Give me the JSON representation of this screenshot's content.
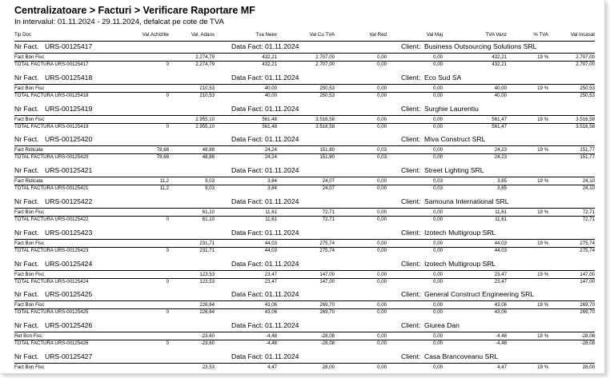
{
  "report": {
    "title": "Centralizatoare > Facturi > Verificare Raportare MF",
    "subtitle": "In intervalul: 01.11.2024 - 29.11.2024, defalcat pe cote de TVA"
  },
  "columns": [
    "Tip Doc",
    "Val.Achizitie",
    "Val. Adaos",
    "Tva Neex",
    "Val Cu TVA",
    "Val Red",
    "Val Maj",
    "TVA Vanz",
    "% TVA",
    "Val Incasat"
  ],
  "labels": {
    "nr_fact": "Nr Fact.",
    "data_fact": "Data Fact:",
    "client": "Client:",
    "total_prefix": "TOTAL FACTURA"
  },
  "invoices": [
    {
      "nr": "URS-00125417",
      "date": "01.11.2024",
      "client": "Business Outsourcing Solutions SRL",
      "row": {
        "type": "Fact Bon Fisc",
        "ach": "",
        "adaos": "2.274,79",
        "tva_neex": "432,21",
        "cu_tva": "2.707,00",
        "red": "0,00",
        "maj": "0,00",
        "tva_vanz": "432,21",
        "pct": "19 %",
        "incasat": "2.707,00"
      },
      "total": {
        "label": "TOTAL FACTURA URS-00125417",
        "ach": "0",
        "adaos": "2.274,79",
        "tva_neex": "432,21",
        "cu_tva": "2.707,00",
        "red": "0,00",
        "maj": "0,00",
        "tva_vanz": "432,21",
        "incasat": "2.707,00"
      }
    },
    {
      "nr": "URS-00125418",
      "date": "01.11.2024",
      "client": "Eco Sud SA",
      "row": {
        "type": "Fact Bon Fisc",
        "ach": "",
        "adaos": "210,53",
        "tva_neex": "40,00",
        "cu_tva": "250,53",
        "red": "0,00",
        "maj": "0,00",
        "tva_vanz": "40,00",
        "pct": "19 %",
        "incasat": "250,53"
      },
      "total": {
        "label": "TOTAL FACTURA URS-00125418",
        "ach": "0",
        "adaos": "210,53",
        "tva_neex": "40,00",
        "cu_tva": "250,53",
        "red": "0,00",
        "maj": "0,00",
        "tva_vanz": "40,00",
        "incasat": "250,53"
      }
    },
    {
      "nr": "URS-00125419",
      "date": "01.11.2024",
      "client": "Surghie Laurentiu",
      "row": {
        "type": "Fact Bon Fisc",
        "ach": "",
        "adaos": "2.955,10",
        "tva_neex": "561,48",
        "cu_tva": "3.516,58",
        "red": "0,00",
        "maj": "0,00",
        "tva_vanz": "561,47",
        "pct": "19 %",
        "incasat": "3.516,58"
      },
      "total": {
        "label": "TOTAL FACTURA URS-00125419",
        "ach": "0",
        "adaos": "2.955,10",
        "tva_neex": "561,48",
        "cu_tva": "3.516,58",
        "red": "0,00",
        "maj": "0,00",
        "tva_vanz": "561,47",
        "incasat": "3.516,58"
      }
    },
    {
      "nr": "URS-00125420",
      "date": "01.11.2024",
      "client": "Miva Construct SRL",
      "row": {
        "type": "Fact Ridicata",
        "ach": "78,68",
        "adaos": "48,88",
        "tva_neex": "24,24",
        "cu_tva": "151,80",
        "red": "0,03",
        "maj": "0,00",
        "tva_vanz": "24,23",
        "pct": "19 %",
        "incasat": "151,77"
      },
      "total": {
        "label": "TOTAL FACTURA URS-00125420",
        "ach": "78,68",
        "adaos": "48,88",
        "tva_neex": "24,24",
        "cu_tva": "151,80",
        "red": "0,03",
        "maj": "0,00",
        "tva_vanz": "24,23",
        "incasat": "151,77"
      }
    },
    {
      "nr": "URS-00125421",
      "date": "01.11.2024",
      "client": "Street Lighting SRL",
      "row": {
        "type": "Fact Ridicata",
        "ach": "11,2",
        "adaos": "9,03",
        "tva_neex": "3,84",
        "cu_tva": "24,07",
        "red": "0,00",
        "maj": "0,03",
        "tva_vanz": "3,85",
        "pct": "19 %",
        "incasat": "24,10"
      },
      "total": {
        "label": "TOTAL FACTURA URS-00125421",
        "ach": "11,2",
        "adaos": "9,03",
        "tva_neex": "3,84",
        "cu_tva": "24,07",
        "red": "0,00",
        "maj": "0,03",
        "tva_vanz": "3,85",
        "incasat": "24,10"
      }
    },
    {
      "nr": "URS-00125422",
      "date": "01.11.2024",
      "client": "Samouna International SRL",
      "row": {
        "type": "Fact Bon Fisc",
        "ach": "",
        "adaos": "61,10",
        "tva_neex": "11,61",
        "cu_tva": "72,71",
        "red": "0,00",
        "maj": "0,00",
        "tva_vanz": "11,61",
        "pct": "19 %",
        "incasat": "72,71"
      },
      "total": {
        "label": "TOTAL FACTURA URS-00125422",
        "ach": "0",
        "adaos": "61,10",
        "tva_neex": "11,61",
        "cu_tva": "72,71",
        "red": "0,00",
        "maj": "0,00",
        "tva_vanz": "11,61",
        "incasat": "72,71"
      }
    },
    {
      "nr": "URS-00125423",
      "date": "01.11.2024",
      "client": "Izotech Multigroup SRL",
      "row": {
        "type": "Fact Bon Fisc",
        "ach": "",
        "adaos": "231,71",
        "tva_neex": "44,03",
        "cu_tva": "275,74",
        "red": "0,00",
        "maj": "0,00",
        "tva_vanz": "44,03",
        "pct": "19 %",
        "incasat": "275,74"
      },
      "total": {
        "label": "TOTAL FACTURA URS-00125423",
        "ach": "0",
        "adaos": "231,71",
        "tva_neex": "44,03",
        "cu_tva": "275,74",
        "red": "0,00",
        "maj": "0,00",
        "tva_vanz": "44,03",
        "incasat": "275,74"
      }
    },
    {
      "nr": "URS-00125424",
      "date": "01.11.2024",
      "client": "Izotech Multigroup SRL",
      "row": {
        "type": "Fact Bon Fisc",
        "ach": "",
        "adaos": "123,53",
        "tva_neex": "23,47",
        "cu_tva": "147,00",
        "red": "0,00",
        "maj": "0,00",
        "tva_vanz": "23,47",
        "pct": "19 %",
        "incasat": "147,00"
      },
      "total": {
        "label": "TOTAL FACTURA URS-00125424",
        "ach": "0",
        "adaos": "123,53",
        "tva_neex": "23,47",
        "cu_tva": "147,00",
        "red": "0,00",
        "maj": "0,00",
        "tva_vanz": "23,47",
        "incasat": "147,00"
      }
    },
    {
      "nr": "URS-00125425",
      "date": "01.11.2024",
      "client": "General Construct Engineering SRL",
      "row": {
        "type": "Fact Bon Fisc",
        "ach": "",
        "adaos": "226,64",
        "tva_neex": "43,06",
        "cu_tva": "269,70",
        "red": "0,00",
        "maj": "0,00",
        "tva_vanz": "43,06",
        "pct": "19 %",
        "incasat": "269,70"
      },
      "total": {
        "label": "TOTAL FACTURA URS-00125425",
        "ach": "0",
        "adaos": "226,64",
        "tva_neex": "43,06",
        "cu_tva": "269,70",
        "red": "0,00",
        "maj": "0,00",
        "tva_vanz": "43,06",
        "incasat": "269,70"
      }
    },
    {
      "nr": "URS-00125426",
      "date": "01.11.2024",
      "client": "Giurea Dan",
      "row": {
        "type": "Ret Bon Fisc",
        "ach": "",
        "adaos": "-23,60",
        "tva_neex": "-4,48",
        "cu_tva": "-28,08",
        "red": "0,00",
        "maj": "0,00",
        "tva_vanz": "-4,48",
        "pct": "19 %",
        "incasat": "-28,08"
      },
      "total": {
        "label": "TOTAL FACTURA URS-00125426",
        "ach": "0",
        "adaos": "-23,60",
        "tva_neex": "-4,48",
        "cu_tva": "-28,08",
        "red": "0,00",
        "maj": "0,00",
        "tva_vanz": "-4,48",
        "incasat": "-28,08"
      }
    },
    {
      "nr": "URS-00125427",
      "date": "01.11.2024",
      "client": "Casa Brancoveanu SRL",
      "row": {
        "type": "Fact Bon Fisc",
        "ach": "",
        "adaos": "23,53",
        "tva_neex": "4,47",
        "cu_tva": "28,00",
        "red": "0,00",
        "maj": "0,00",
        "tva_vanz": "4,47",
        "pct": "19 %",
        "incasat": "28,00"
      },
      "total": null
    }
  ]
}
